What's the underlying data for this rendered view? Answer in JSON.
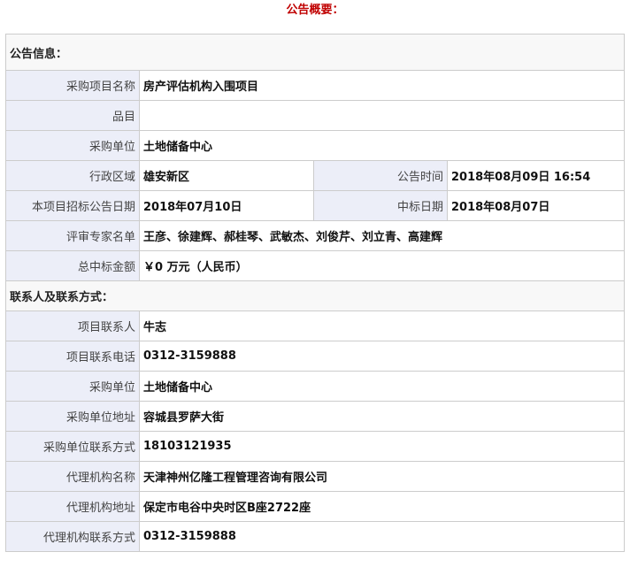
{
  "title": "公告概要：",
  "sections": {
    "announcement": "公告信息：",
    "contact": "联系人及联系方式："
  },
  "announcement": {
    "project_name_label": "采购项目名称",
    "project_name": "房产评估机构入围项目",
    "item_label": "品目",
    "item": "",
    "purchaser_label": "采购单位",
    "purchaser": "土地储备中心",
    "region_label": "行政区域",
    "region": "雄安新区",
    "publish_time_label": "公告时间",
    "publish_time": "2018年08月09日 16:54",
    "tender_date_label": "本项目招标公告日期",
    "tender_date": "2018年07月10日",
    "award_date_label": "中标日期",
    "award_date": "2018年08月07日",
    "experts_label": "评审专家名单",
    "experts": "王彦、徐建辉、郝桂琴、武敏杰、刘俊芹、刘立青、高建辉",
    "total_amount_label": "总中标金额",
    "total_amount": "￥0 万元（人民币）"
  },
  "contact": {
    "project_contact_label": "项目联系人",
    "project_contact": "牛志",
    "project_phone_label": "项目联系电话",
    "project_phone": "0312-3159888",
    "purchaser_label": "采购单位",
    "purchaser": "土地储备中心",
    "purchaser_address_label": "采购单位地址",
    "purchaser_address": "容城县罗萨大街",
    "purchaser_contact_label": "采购单位联系方式",
    "purchaser_contact": "18103121935",
    "agency_name_label": "代理机构名称",
    "agency_name": "天津神州亿隆工程管理咨询有限公司",
    "agency_address_label": "代理机构地址",
    "agency_address": "保定市电谷中央时区B座2722座",
    "agency_contact_label": "代理机构联系方式",
    "agency_contact": "0312-3159888"
  }
}
